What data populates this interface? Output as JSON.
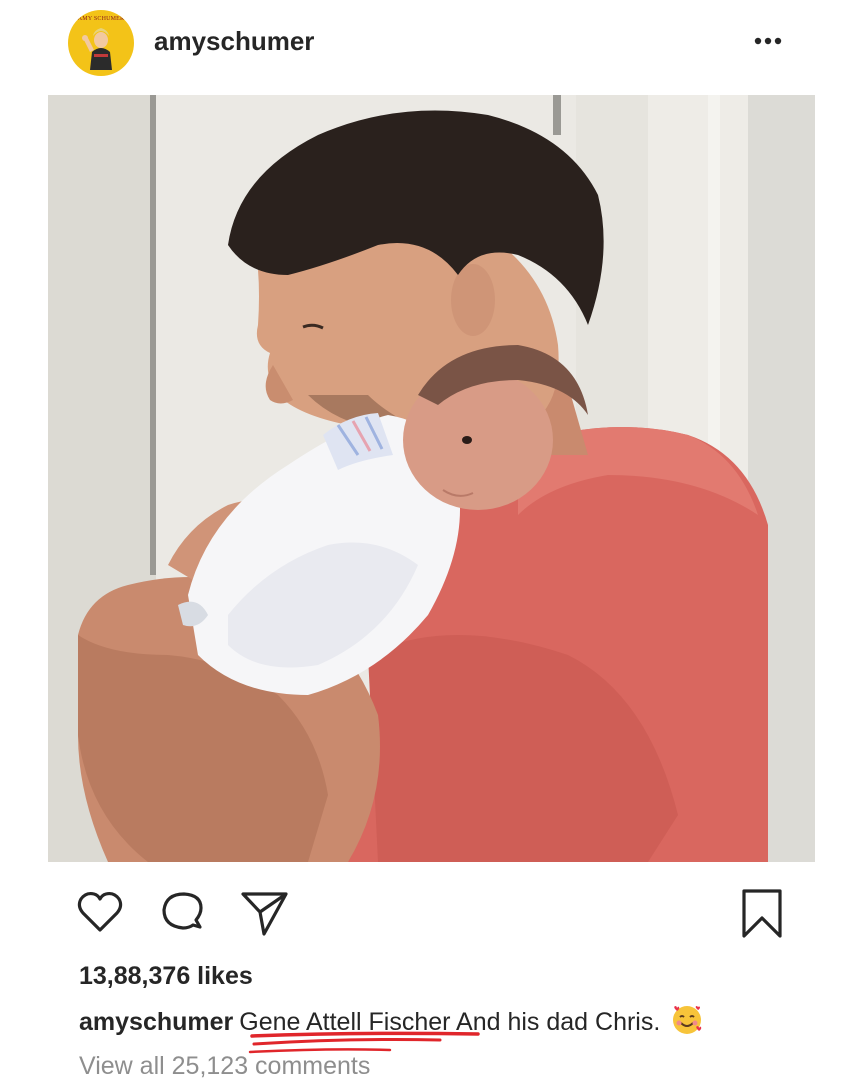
{
  "post": {
    "username": "amyschumer",
    "avatar_label": "AMY SCHUMER",
    "more_icon": "more-horizontal-icon",
    "likes": "13,88,376 likes",
    "caption": {
      "username": "amyschumer",
      "text": "Gene Attell Fischer And his dad Chris.",
      "emoji": "smiling-face-with-hearts"
    },
    "view_comments": "View all 25,123 comments"
  },
  "actions": {
    "like_icon": "heart-icon",
    "comment_icon": "comment-icon",
    "share_icon": "paper-plane-icon",
    "save_icon": "bookmark-icon"
  },
  "photo": {
    "subject": "man in red t-shirt holding newborn baby"
  },
  "colors": {
    "text": "#262626",
    "muted": "#8e8e8e",
    "shirt": "#d9675f",
    "wall": "#e6e4de",
    "annotation": "#e0262b",
    "avatar_bg": "#f3c318"
  }
}
